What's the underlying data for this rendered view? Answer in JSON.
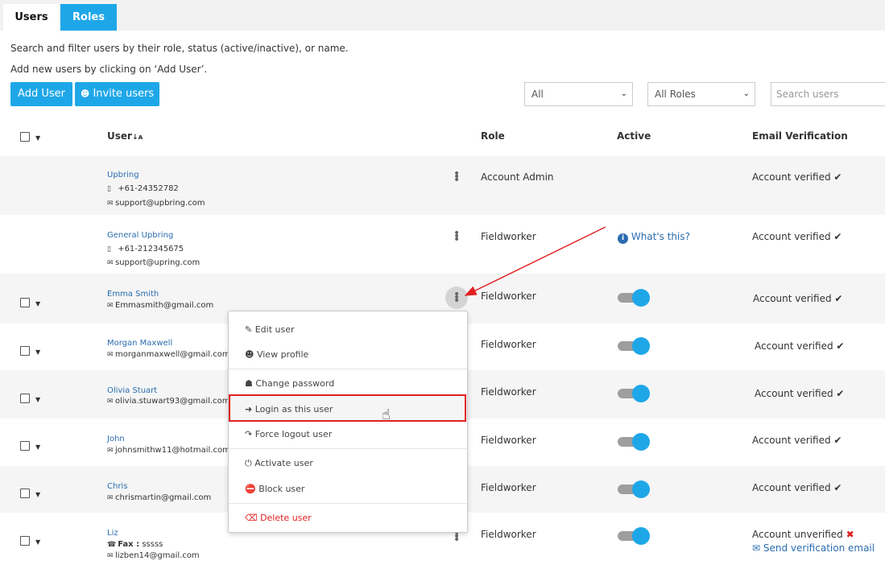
{
  "tabs": {
    "users": "Users",
    "roles": "Roles"
  },
  "description": {
    "line1": "Search and filter users by their role, status (active/inactive), or name.",
    "line2": "Add new users by clicking on ‘Add User’."
  },
  "toolbar": {
    "add_user": "Add User",
    "invite_users": "Invite users",
    "status_filter": "All",
    "role_filter": "All Roles",
    "search_placeholder": "Search users"
  },
  "columns": {
    "user": "User",
    "role": "Role",
    "active": "Active",
    "email_verification": "Email Verification"
  },
  "help_link": "What's this?",
  "users": [
    {
      "name": "Upbring",
      "phone": "+61-24352782",
      "email": "support@upbring.com",
      "role": "Account Admin",
      "verification": "Account verified"
    },
    {
      "name": "General Upbring",
      "phone": "+61-212345675",
      "email": "support@upring.com",
      "role": "Fieldworker",
      "verification": "Account verified"
    },
    {
      "name": "Emma Smith",
      "email": "Emmasmith@gmail.com",
      "role": "Fieldworker",
      "verification": "Account verified"
    },
    {
      "name": "Morgan Maxwell",
      "email": "morganmaxwell@gmail.com",
      "role": "Fieldworker",
      "verification": "Account verified"
    },
    {
      "name": "Olivia Stuart",
      "email": "olivia.stuwart93@gmail.com",
      "role": "Fieldworker",
      "verification": "Account verified"
    },
    {
      "name": "John",
      "email": "johnsmithw11@hotmail.com",
      "role": "Fieldworker",
      "verification": "Account verified"
    },
    {
      "name": "Chris",
      "email": "chrismartin@gmail.com",
      "role": "Fieldworker",
      "verification": "Account verified"
    },
    {
      "name": "Liz",
      "fax_label": "Fax :",
      "fax": "sssss",
      "email": "lizben14@gmail.com",
      "role": "Fieldworker",
      "verification": "Account unverified",
      "send_verification": "Send verification email"
    }
  ],
  "context_menu": {
    "edit_user": "Edit user",
    "view_profile": "View profile",
    "change_password": "Change password",
    "login_as_user": "Login as this user",
    "force_logout": "Force logout user",
    "activate_user": "Activate user",
    "block_user": "Block user",
    "delete_user": "Delete user"
  },
  "colors": {
    "accent": "#1ea7e8",
    "link": "#2a6db0",
    "danger": "#e02020",
    "highlight": "#e02020"
  }
}
